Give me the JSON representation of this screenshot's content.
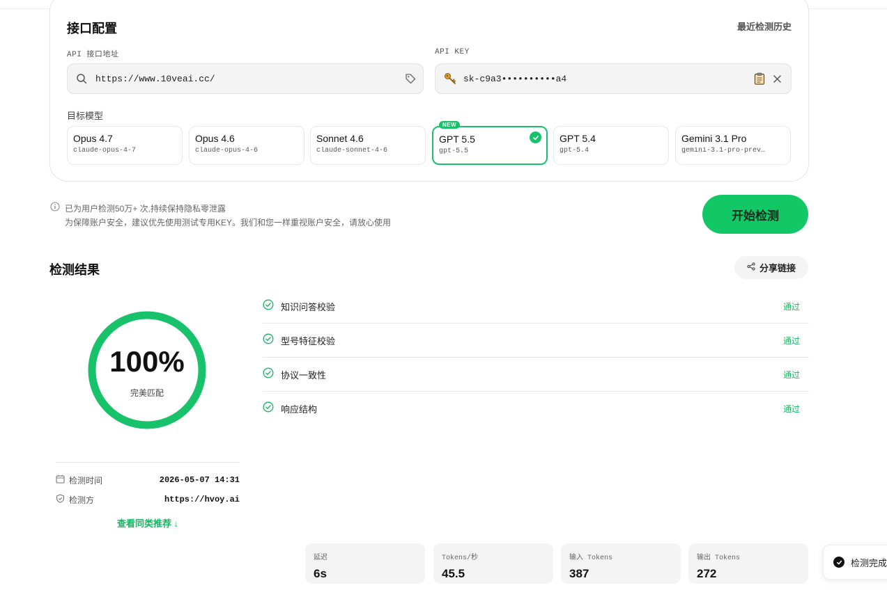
{
  "config": {
    "title": "接口配置",
    "history_link": "最近检测历史",
    "api_url": {
      "label": "API 接口地址",
      "value": "https://www.10veai.cc/",
      "icon": "search-icon",
      "tag_icon": "tag-icon"
    },
    "api_key": {
      "label": "API KEY",
      "value": "sk-c9a3••••••••••a4",
      "icon": "key-icon",
      "paste_icon": "clipboard-icon",
      "clear_icon": "close-icon"
    },
    "models_label": "目标模型",
    "models": [
      {
        "name": "Opus 4.7",
        "id": "claude-opus-4-7"
      },
      {
        "name": "Opus 4.6",
        "id": "claude-opus-4-6"
      },
      {
        "name": "Sonnet 4.6",
        "id": "claude-sonnet-4-6"
      },
      {
        "name": "GPT 5.5",
        "id": "gpt-5.5",
        "badge": "NEW",
        "selected": true
      },
      {
        "name": "GPT 5.4",
        "id": "gpt-5.4"
      },
      {
        "name": "Gemini 3.1 Pro",
        "id": "gemini-3.1-pro-prev…"
      }
    ]
  },
  "notice": {
    "line1": "已为用户检测50万+ 次,持续保持隐私零泄露",
    "line2": "为保障账户安全，建议优先使用测试专用KEY。我们和您一样重视账户安全，请放心使用"
  },
  "start_button": "开始检测",
  "results": {
    "title": "检测结果",
    "share_button": "分享链接",
    "score": {
      "percent": "100%",
      "fraction": 1.0,
      "label": "完美匹配"
    },
    "checks": [
      {
        "name": "知识问答校验",
        "status": "通过"
      },
      {
        "name": "型号特征校验",
        "status": "通过"
      },
      {
        "name": "协议一致性",
        "status": "通过"
      },
      {
        "name": "响应结构",
        "status": "通过"
      }
    ],
    "meta": {
      "time_label": "检测时间",
      "time_value": "2026-05-07 14:31",
      "tester_label": "检测方",
      "tester_value": "https://hvoy.ai"
    },
    "similar_link": "查看同类推荐 ↓",
    "stats": [
      {
        "label": "延迟",
        "value": "6s"
      },
      {
        "label": "Tokens/秒",
        "value": "45.5"
      },
      {
        "label": "输入 Tokens",
        "value": "387"
      },
      {
        "label": "输出 Tokens",
        "value": "272"
      }
    ]
  },
  "toast": {
    "text": "检测完成"
  },
  "colors": {
    "accent": "#17c26a",
    "button": "#12c866",
    "pass": "#17b463"
  }
}
